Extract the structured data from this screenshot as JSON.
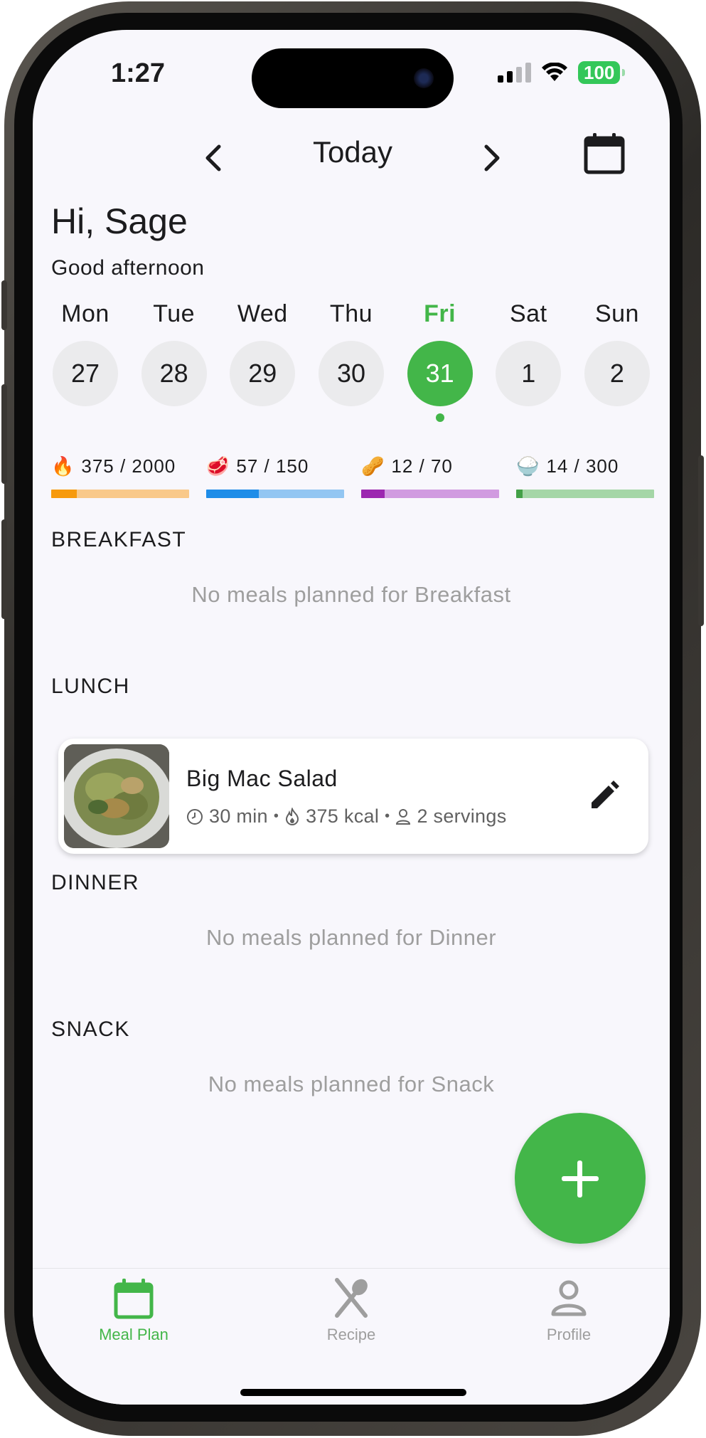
{
  "status_bar": {
    "time": "1:27",
    "battery": "100"
  },
  "header": {
    "title": "Today"
  },
  "greeting": {
    "title": "Hi, Sage",
    "subtitle": "Good afternoon"
  },
  "week": [
    {
      "name": "Mon",
      "num": "27",
      "selected": false
    },
    {
      "name": "Tue",
      "num": "28",
      "selected": false
    },
    {
      "name": "Wed",
      "num": "29",
      "selected": false
    },
    {
      "name": "Thu",
      "num": "30",
      "selected": false
    },
    {
      "name": "Fri",
      "num": "31",
      "selected": true
    },
    {
      "name": "Sat",
      "num": "1",
      "selected": false
    },
    {
      "name": "Sun",
      "num": "2",
      "selected": false
    }
  ],
  "macros": [
    {
      "icon": "fire-icon",
      "glyph": "🔥",
      "label": "375 / 2000",
      "current": 375,
      "goal": 2000,
      "color": "#f79a0d",
      "track": "#f9c98a"
    },
    {
      "icon": "meat-icon",
      "glyph": "🥩",
      "label": "57 / 150",
      "current": 57,
      "goal": 150,
      "color": "#1f8de8",
      "track": "#93c6f2"
    },
    {
      "icon": "peanut-icon",
      "glyph": "🥜",
      "label": "12 / 70",
      "current": 12,
      "goal": 70,
      "color": "#9c27b0",
      "track": "#d19be0"
    },
    {
      "icon": "rice-bowl-icon",
      "glyph": "🍚",
      "label": "14 / 300",
      "current": 14,
      "goal": 300,
      "color": "#43a047",
      "track": "#a5d6a7"
    }
  ],
  "sections": {
    "breakfast": {
      "title": "BREAKFAST",
      "empty": "No meals planned for Breakfast"
    },
    "lunch": {
      "title": "LUNCH"
    },
    "dinner": {
      "title": "DINNER",
      "empty": "No meals planned for Dinner"
    },
    "snack": {
      "title": "SNACK",
      "empty": "No meals planned for Snack"
    }
  },
  "lunch_meal": {
    "name": "Big Mac Salad",
    "time": "30 min",
    "kcal": "375 kcal",
    "servings": "2 servings"
  },
  "bottom_nav": [
    {
      "label": "Meal Plan",
      "active": true
    },
    {
      "label": "Recipe",
      "active": false
    },
    {
      "label": "Profile",
      "active": false
    }
  ],
  "colors": {
    "accent": "#43b649",
    "muted": "#9e9e9e"
  }
}
